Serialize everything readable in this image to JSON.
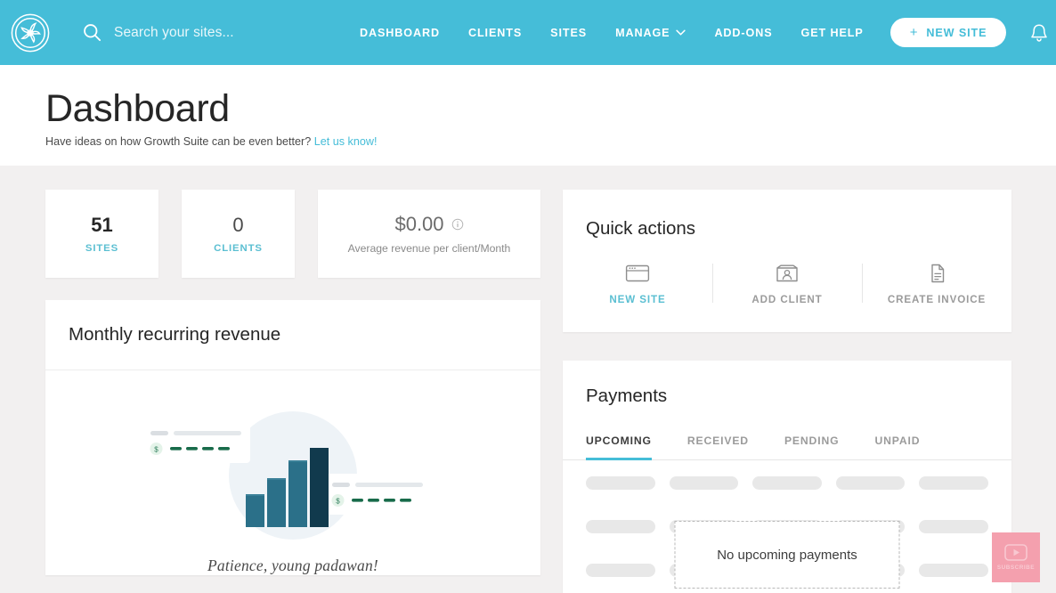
{
  "navbar": {
    "logo_icon": "pinwheel-logo-icon",
    "search": {
      "icon": "search-icon",
      "placeholder": "Search your sites...",
      "value": ""
    },
    "links": [
      {
        "label": "DASHBOARD",
        "name": "dashboard"
      },
      {
        "label": "CLIENTS",
        "name": "clients"
      },
      {
        "label": "SITES",
        "name": "sites"
      },
      {
        "label": "MANAGE",
        "name": "manage",
        "has_caret": true
      },
      {
        "label": "ADD-ONS",
        "name": "add-ons"
      },
      {
        "label": "GET HELP",
        "name": "get-help"
      }
    ],
    "new_site_button": {
      "label": "NEW SITE",
      "plus": "+"
    },
    "bell_icon": "notification-bell-icon",
    "avatar_caret_icon": "chevron-down-icon",
    "background_color": "#45bdd8"
  },
  "header": {
    "title": "Dashboard",
    "subtitle_prefix": "Have ideas on how Growth Suite can be even better? ",
    "subtitle_link": "Let us know!",
    "link_color": "#45bdd8"
  },
  "stats": [
    {
      "value": "51",
      "label": "SITES",
      "name": "sites"
    },
    {
      "value": "0",
      "label": "CLIENTS",
      "name": "clients"
    },
    {
      "value": "$0.00",
      "label": "Average revenue per client/Month",
      "name": "average-revenue",
      "info_icon": "info-icon"
    }
  ],
  "mrr": {
    "title": "Monthly recurring revenue",
    "caption": "Patience, young padawan!",
    "illustration": "bar-chart-illustration"
  },
  "quick_actions": {
    "title": "Quick actions",
    "items": [
      {
        "label": "NEW SITE",
        "icon": "browser-window-icon",
        "active": true
      },
      {
        "label": "ADD CLIENT",
        "icon": "client-card-icon",
        "active": false
      },
      {
        "label": "CREATE INVOICE",
        "icon": "document-invoice-icon",
        "active": false
      }
    ]
  },
  "payments": {
    "title": "Payments",
    "tabs": [
      {
        "label": "UPCOMING",
        "active": true
      },
      {
        "label": "RECEIVED",
        "active": false
      },
      {
        "label": "PENDING",
        "active": false
      },
      {
        "label": "UNPAID",
        "active": false
      }
    ],
    "empty_message": "No upcoming payments",
    "skeleton_rows": 3,
    "skeleton_cells_per_row": 5
  },
  "subscribe_widget": {
    "label": "SUBSCRIBE",
    "icon": "youtube-play-icon",
    "color": "#f4a0ae"
  }
}
